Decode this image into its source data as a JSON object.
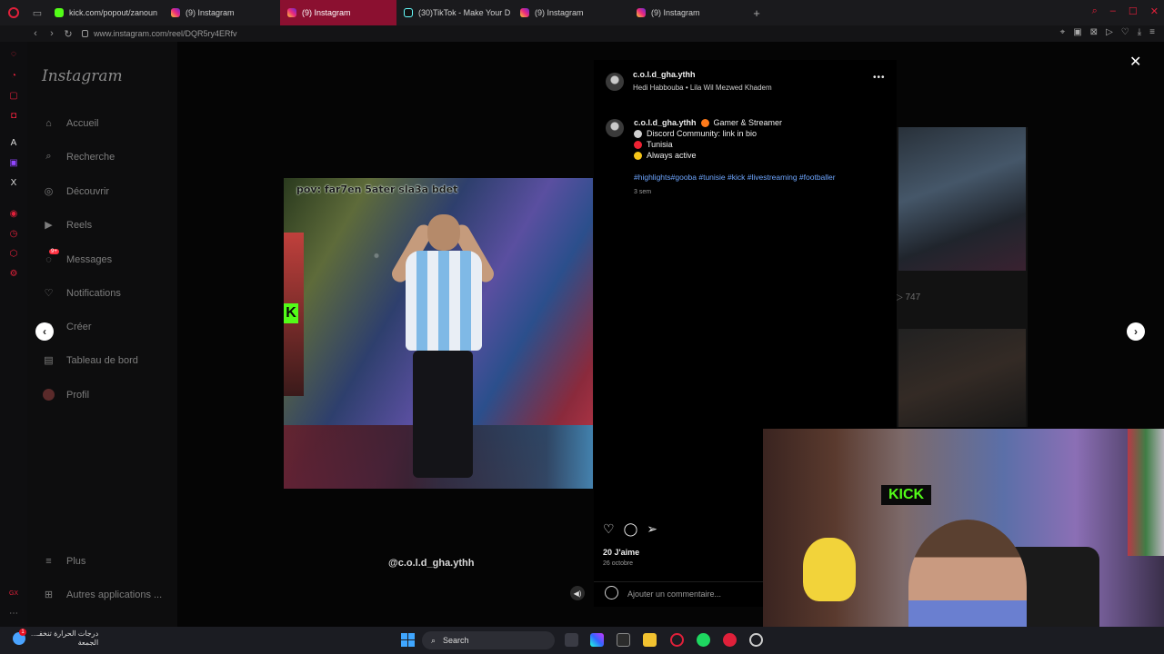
{
  "browser": {
    "tabs": [
      {
        "label": "kick.com/popout/zanoun",
        "favicon": "kick-icon",
        "active": false
      },
      {
        "label": "(9) Instagram",
        "favicon": "instagram-icon",
        "active": false
      },
      {
        "label": "(9) Instagram",
        "favicon": "instagram-icon",
        "active": true
      },
      {
        "label": "(30)TikTok - Make Your D",
        "favicon": "tiktok-icon",
        "active": false
      },
      {
        "label": "(9) Instagram",
        "favicon": "instagram-icon",
        "active": false
      },
      {
        "label": "(9) Instagram",
        "favicon": "instagram-icon",
        "active": false
      }
    ],
    "url": "www.instagram.com/reel/DQR5ry4ERfv",
    "accent": "#e0203a"
  },
  "instagram": {
    "logo": "Instagram",
    "nav": [
      {
        "label": "Accueil",
        "icon": "home-icon"
      },
      {
        "label": "Recherche",
        "icon": "search-icon"
      },
      {
        "label": "Découvrir",
        "icon": "compass-icon"
      },
      {
        "label": "Reels",
        "icon": "reels-icon"
      },
      {
        "label": "Messages",
        "icon": "messenger-icon",
        "badge": "9+"
      },
      {
        "label": "Notifications",
        "icon": "heart-icon"
      },
      {
        "label": "Créer",
        "icon": "plus-icon"
      },
      {
        "label": "Tableau de bord",
        "icon": "dashboard-icon"
      },
      {
        "label": "Profil",
        "icon": "avatar-icon"
      }
    ],
    "more": "Plus",
    "other_apps": "Autres applications ..."
  },
  "reel": {
    "caption_overlay": "pov: far7en 5ater sla3a bdet",
    "handle": "@c.o.l.d_gha.ythh"
  },
  "post": {
    "username": "c.o.l.d_gha.ythh",
    "audio": "Hedi Habbouba • Lila Wil Mezwed Khadem",
    "bio_title": "Gamer & Streamer",
    "bio_lines": [
      "Discord Community: link in bio",
      "Tunisia",
      "Always active"
    ],
    "hashtags": "#highlights#gooba #tunisie #kick #livestreaming #footballer",
    "age": "3 sem",
    "likes": "20 J'aime",
    "date": "26 octobre",
    "comment_placeholder": "Ajouter un commentaire..."
  },
  "background": {
    "count": "747"
  },
  "taskbar": {
    "weather_text": "درجات الحرارة تنخفـ...",
    "weather_sub": "الجمعة",
    "weather_badge": "1",
    "search_label": "Search"
  }
}
